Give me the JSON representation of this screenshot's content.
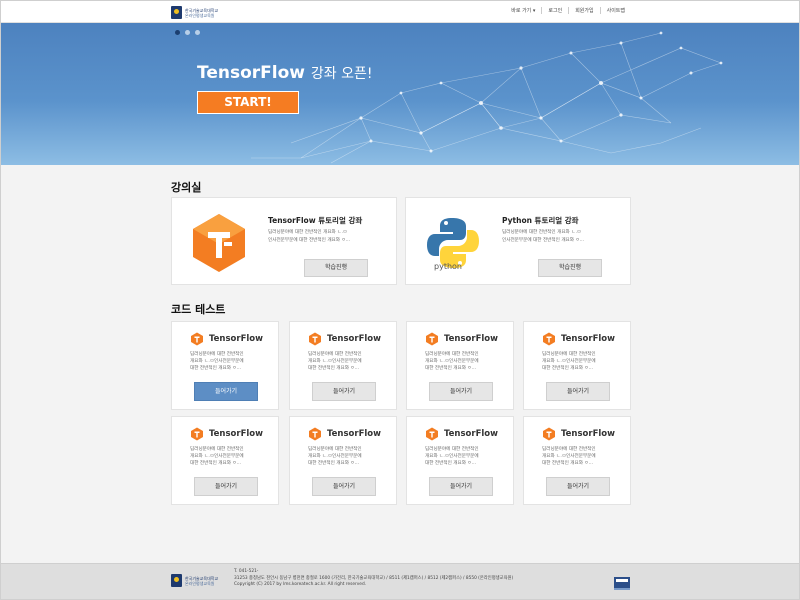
{
  "header": {
    "logo_line1": "한국기술교육대학교",
    "logo_line2": "온라인평생교육원",
    "nav": [
      "바로 가기 ▾",
      "로그인",
      "회원가입",
      "사이트맵"
    ]
  },
  "hero": {
    "title_main": "TensorFlow",
    "title_sub": "강좌 오픈!",
    "start_label": "START!",
    "slides": 3,
    "active_slide": 1
  },
  "lectures": {
    "section_title": "강의실",
    "items": [
      {
        "title": "TensorFlow 튜토리얼 강좌",
        "desc_line1": "딥러닝분야에 대한 전반적인 개요와 ㄴ.ㅁ",
        "desc_line2": "인사전문부문에 대한 전반적인 개요와 ㅇ...",
        "button": "학습진행",
        "icon": "tensorflow-logo-icon"
      },
      {
        "title": "Python 튜토리얼 강좌",
        "desc_line1": "딥러닝분야에 대한 전반적인 개요와 ㄴ.ㅁ",
        "desc_line2": "인사전문부문에 대한 전반적인 개요와 ㅇ...",
        "button": "학습진행",
        "icon": "python-logo-icon",
        "icon_text": "python"
      }
    ]
  },
  "code_test": {
    "section_title": "코드 테스트",
    "items": [
      {
        "name": "TensorFlow",
        "desc1": "딥러닝분야에 대한 전반적인",
        "desc2": "개요와 ㄴ.ㅁ인사전문부문에",
        "desc3": "대한 전반적인 개요와 ㅇ...",
        "button": "들어가기",
        "primary": true
      },
      {
        "name": "TensorFlow",
        "desc1": "딥러닝분야에 대한 전반적인",
        "desc2": "개요와 ㄴ.ㅁ인사전문부문에",
        "desc3": "대한 전반적인 개요와 ㅇ...",
        "button": "들어가기",
        "primary": false
      },
      {
        "name": "TensorFlow",
        "desc1": "딥러닝분야에 대한 전반적인",
        "desc2": "개요와 ㄴ.ㅁ인사전문부문에",
        "desc3": "대한 전반적인 개요와 ㅇ...",
        "button": "들어가기",
        "primary": false
      },
      {
        "name": "TensorFlow",
        "desc1": "딥러닝분야에 대한 전반적인",
        "desc2": "개요와 ㄴ.ㅁ인사전문부문에",
        "desc3": "대한 전반적인 개요와 ㅇ...",
        "button": "들어가기",
        "primary": false
      },
      {
        "name": "TensorFlow",
        "desc1": "딥러닝분야에 대한 전반적인",
        "desc2": "개요와 ㄴ.ㅁ인사전문부문에",
        "desc3": "대한 전반적인 개요와 ㅇ...",
        "button": "들어가기",
        "primary": false
      },
      {
        "name": "TensorFlow",
        "desc1": "딥러닝분야에 대한 전반적인",
        "desc2": "개요와 ㄴ.ㅁ인사전문부문에",
        "desc3": "대한 전반적인 개요와 ㅇ...",
        "button": "들어가기",
        "primary": false
      },
      {
        "name": "TensorFlow",
        "desc1": "딥러닝분야에 대한 전반적인",
        "desc2": "개요와 ㄴ.ㅁ인사전문부문에",
        "desc3": "대한 전반적인 개요와 ㅇ...",
        "button": "들어가기",
        "primary": false
      },
      {
        "name": "TensorFlow",
        "desc1": "딥러닝분야에 대한 전반적인",
        "desc2": "개요와 ㄴ.ㅁ인사전문부문에",
        "desc3": "대한 전반적인 개요와 ㅇ...",
        "button": "들어가기",
        "primary": false
      }
    ]
  },
  "footer": {
    "logo_line1": "한국기술교육대학교",
    "logo_line2": "온라인평생교육원",
    "line1": "T. 041-521-",
    "line2": "31253 충청남도 천안시 동남구 병천면 충절로 1600 (가전리, 한국기술교육대학교) / 8511 (제1캠퍼스) / 8512 (제2캠퍼스) / 8550 (온라인평생교육원)",
    "line3": "Copyright (C) 2017 by lms.koreatech.ac.kr. All right reserved."
  },
  "colors": {
    "accent_orange": "#f57c22",
    "hero_blue": "#4d82bf",
    "primary_button": "#5d8ec5",
    "tf_orange": "#f37d22",
    "python_blue": "#3776ab",
    "python_yellow": "#ffd43b"
  }
}
